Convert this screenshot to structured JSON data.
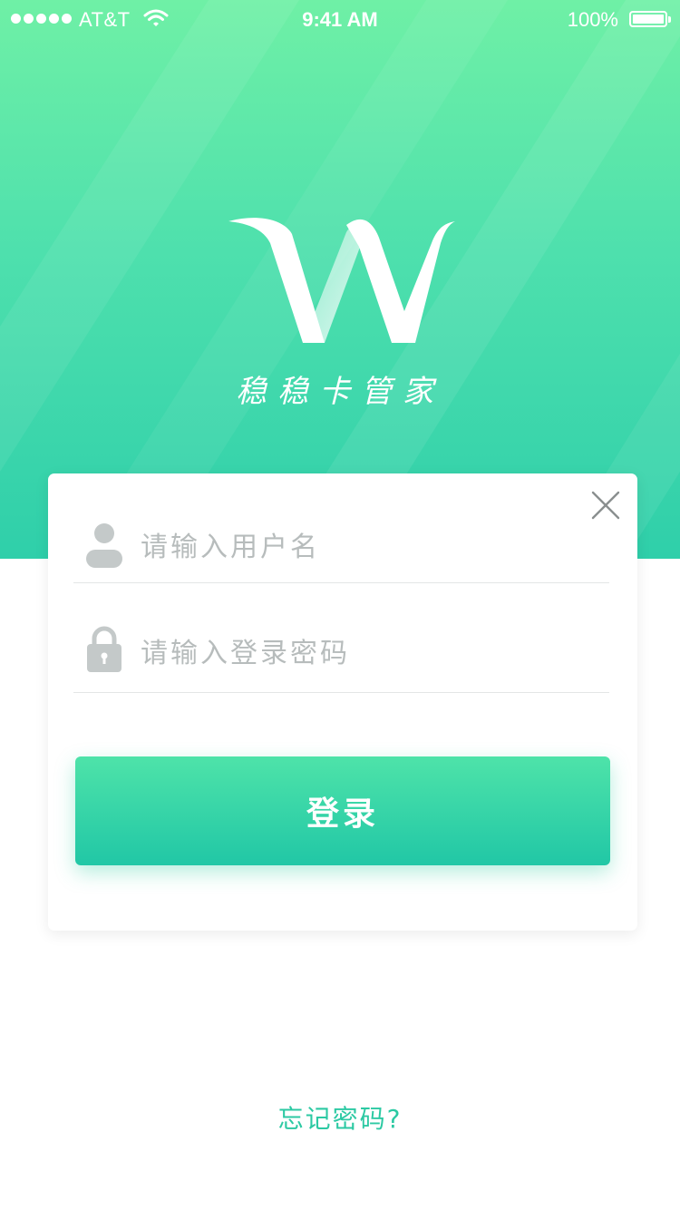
{
  "status_bar": {
    "carrier": "AT&T",
    "time": "9:41 AM",
    "battery": "100%"
  },
  "brand": {
    "logo_icon": "w-ribbon-logo-icon",
    "name": "稳稳卡管家"
  },
  "login_form": {
    "close_icon": "close-icon",
    "username": {
      "icon": "user-icon",
      "placeholder": "请输入用户名",
      "value": ""
    },
    "password": {
      "icon": "lock-icon",
      "placeholder": "请输入登录密码",
      "value": ""
    },
    "submit_label": "登录"
  },
  "forgot_password": "忘记密码?",
  "colors": {
    "accent": "#2cc9a3",
    "gradient_top": "#6ff0a6",
    "gradient_bottom": "#2fcfaa",
    "placeholder": "#b7bcbc",
    "icon_gray": "#c4c9c9"
  }
}
